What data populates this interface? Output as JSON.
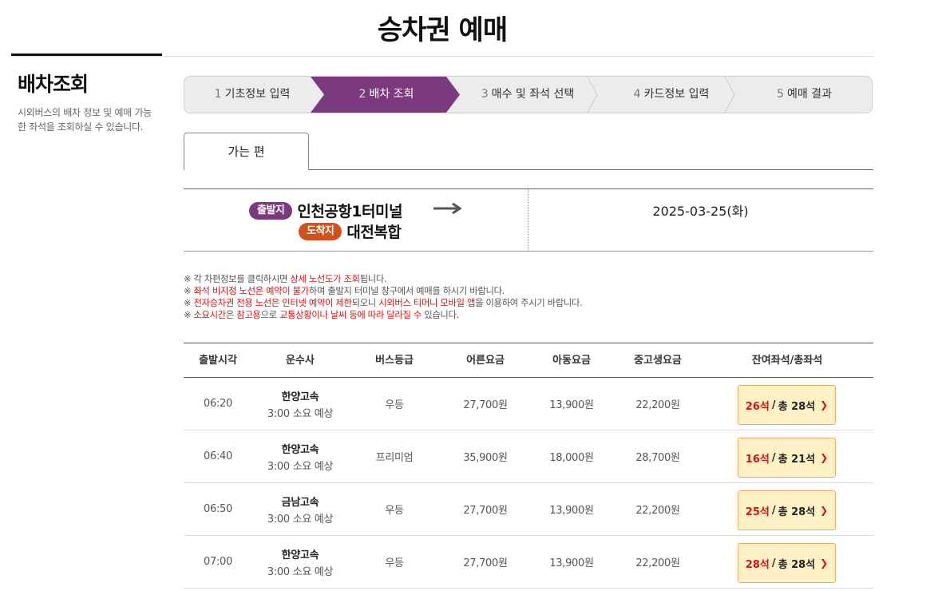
{
  "page": {
    "title": "승차권 예매"
  },
  "sidebar": {
    "title": "배차조회",
    "description": "시외버스의 배차 정보 및 예매 가능한 좌석을 조회하실 수 있습니다."
  },
  "steps": [
    {
      "num": "1",
      "label": "기초정보 입력",
      "active": false
    },
    {
      "num": "2",
      "label": "배차 조회",
      "active": true
    },
    {
      "num": "3",
      "label": "매수 및 좌석 선택",
      "active": false
    },
    {
      "num": "4",
      "label": "카드정보 입력",
      "active": false
    },
    {
      "num": "5",
      "label": "예매 결과",
      "active": false
    }
  ],
  "tabs": [
    {
      "label": "가는 편"
    }
  ],
  "route": {
    "departure_badge": "출발지",
    "departure": "인천공항1터미널",
    "arrival_badge": "도착지",
    "arrival": "대전복합",
    "date": "2025-03-25(화)"
  },
  "notes": [
    [
      {
        "t": "※ 각 차편정보를 클릭하시면 ",
        "red": false
      },
      {
        "t": "상세 노선도가 조회",
        "red": true
      },
      {
        "t": "됩니다.",
        "red": false
      }
    ],
    [
      {
        "t": "※ ",
        "red": false
      },
      {
        "t": "좌석 비지정 노선은 예약이 불가",
        "red": true
      },
      {
        "t": "하며 출발지 터미널 창구에서 예매를 하시기 바랍니다.",
        "red": false
      }
    ],
    [
      {
        "t": "※ ",
        "red": false
      },
      {
        "t": "전자승차권 전용 노선은 인터넷 예약이 제한",
        "red": true
      },
      {
        "t": "되오니 ",
        "red": false
      },
      {
        "t": "시외버스 티머니 모바일 앱",
        "red": true
      },
      {
        "t": "을 이용하여 주시기 바랍니다.",
        "red": false
      }
    ],
    [
      {
        "t": "※ ",
        "red": false
      },
      {
        "t": "소요시간",
        "red": true
      },
      {
        "t": "은 ",
        "red": false
      },
      {
        "t": "참고용",
        "red": true
      },
      {
        "t": "으로 ",
        "red": false
      },
      {
        "t": "교통상황이나 날씨 등에 따라 달라질 수",
        "red": true
      },
      {
        "t": " 있습니다.",
        "red": false
      }
    ]
  ],
  "table": {
    "headers": [
      "출발시각",
      "운수사",
      "버스등급",
      "어른요금",
      "아동요금",
      "중고생요금",
      "잔여좌석/총좌석"
    ],
    "rows": [
      {
        "time": "06:20",
        "company": "한양고속",
        "duration": "3:00 소요 예상",
        "grade": "우등",
        "adult": "27,700원",
        "child": "13,900원",
        "youth": "22,200원",
        "remaining": "26석",
        "total": "총 28석"
      },
      {
        "time": "06:40",
        "company": "한양고속",
        "duration": "3:00 소요 예상",
        "grade": "프리미엄",
        "adult": "35,900원",
        "child": "18,000원",
        "youth": "28,700원",
        "remaining": "16석",
        "total": "총 21석"
      },
      {
        "time": "06:50",
        "company": "금남고속",
        "duration": "3:00 소요 예상",
        "grade": "우등",
        "adult": "27,700원",
        "child": "13,900원",
        "youth": "22,200원",
        "remaining": "25석",
        "total": "총 28석"
      },
      {
        "time": "07:00",
        "company": "한양고속",
        "duration": "3:00 소요 예상",
        "grade": "우등",
        "adult": "27,700원",
        "child": "13,900원",
        "youth": "22,200원",
        "remaining": "28석",
        "total": "총 28석"
      }
    ]
  },
  "colors": {
    "active_step": "#7b3a7e",
    "departure_badge": "#7b3a7e",
    "arrival_badge": "#d2501a",
    "highlight_red": "#d21414",
    "seat_button_bg": "#fff1c6"
  }
}
